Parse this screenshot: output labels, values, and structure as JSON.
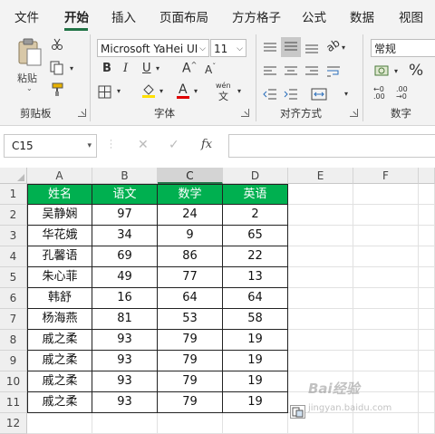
{
  "tabs": [
    {
      "label": "文件",
      "active": false
    },
    {
      "label": "开始",
      "active": true
    },
    {
      "label": "插入",
      "active": false
    },
    {
      "label": "页面布局",
      "active": false
    },
    {
      "label": "方方格子",
      "active": false
    },
    {
      "label": "公式",
      "active": false
    },
    {
      "label": "数据",
      "active": false
    },
    {
      "label": "视图",
      "active": false
    }
  ],
  "ribbon": {
    "clipboard": {
      "label": "剪贴板",
      "paste_label": "粘贴"
    },
    "font": {
      "label": "字体",
      "font_name": "Microsoft YaHei UI",
      "font_size": "11",
      "wen_label": "wén"
    },
    "alignment": {
      "label": "对齐方式"
    },
    "number": {
      "label": "数字",
      "format": "常规"
    }
  },
  "formula_bar": {
    "name_box": "C15",
    "fx": "fx",
    "formula": ""
  },
  "columns": [
    "A",
    "B",
    "C",
    "D",
    "E",
    "F"
  ],
  "selected_column": "C",
  "rows": [
    "1",
    "2",
    "3",
    "4",
    "5",
    "6",
    "7",
    "8",
    "9",
    "10",
    "11",
    "12"
  ],
  "table": {
    "header": [
      "姓名",
      "语文",
      "数学",
      "英语"
    ],
    "rows": [
      [
        "吴静娴",
        "97",
        "24",
        "2"
      ],
      [
        "华花娥",
        "34",
        "9",
        "65"
      ],
      [
        "孔馨语",
        "69",
        "86",
        "22"
      ],
      [
        "朱心菲",
        "49",
        "77",
        "13"
      ],
      [
        "韩舒",
        "16",
        "64",
        "64"
      ],
      [
        "杨海燕",
        "81",
        "53",
        "58"
      ],
      [
        "戚之柔",
        "93",
        "79",
        "19"
      ],
      [
        "戚之柔",
        "93",
        "79",
        "19"
      ],
      [
        "戚之柔",
        "93",
        "79",
        "19"
      ],
      [
        "戚之柔",
        "93",
        "79",
        "19"
      ]
    ]
  },
  "colors": {
    "accent": "#217346",
    "header_fill": "#00b050",
    "font_color_bar": "#e00000",
    "highlight_bar": "#ffe000"
  },
  "watermark": {
    "text": "Bai",
    "suffix": "经验",
    "url": "jingyan.baidu.com"
  }
}
